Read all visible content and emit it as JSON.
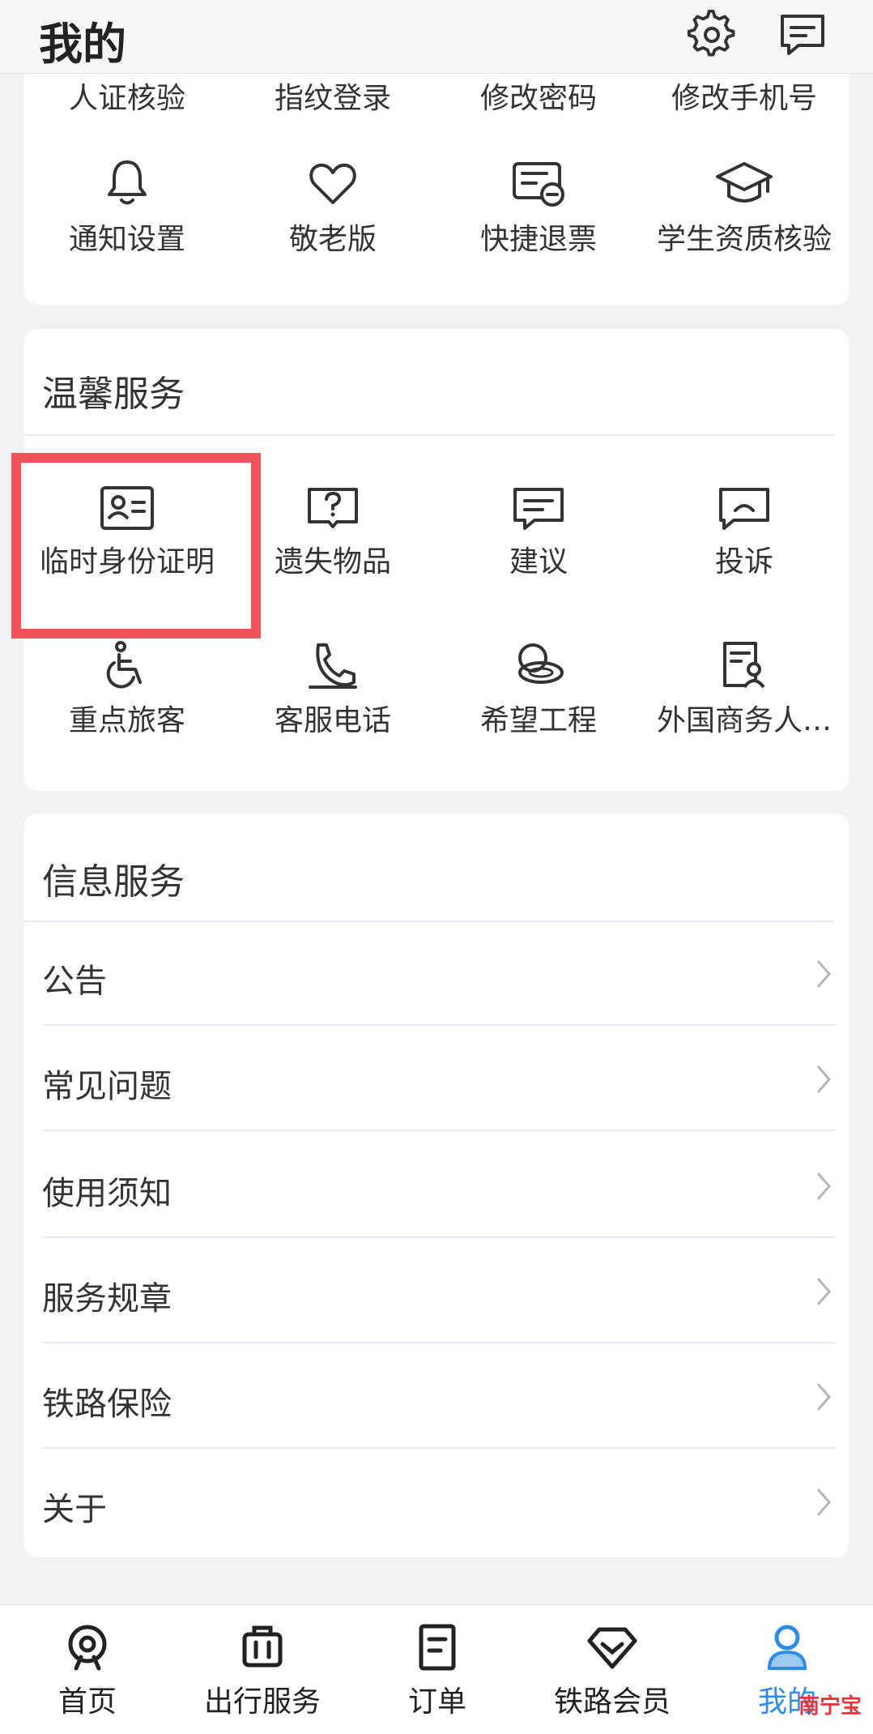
{
  "header": {
    "title": "我的",
    "settings_icon": "gear-icon",
    "message_icon": "message-icon"
  },
  "account_settings": {
    "row1": [
      "人证核验",
      "指纹登录",
      "修改密码",
      "修改手机号"
    ],
    "row2": [
      {
        "label": "通知设置",
        "icon": "bell-icon"
      },
      {
        "label": "敬老版",
        "icon": "heart-icon"
      },
      {
        "label": "快捷退票",
        "icon": "ticket-refund-icon"
      },
      {
        "label": "学生资质核验",
        "icon": "graduation-cap-icon"
      }
    ]
  },
  "warm_services": {
    "title": "温馨服务",
    "items": [
      {
        "label": "临时身份证明",
        "icon": "id-card-icon"
      },
      {
        "label": "遗失物品",
        "icon": "question-box-icon"
      },
      {
        "label": "建议",
        "icon": "suggestion-icon"
      },
      {
        "label": "投诉",
        "icon": "complaint-icon"
      },
      {
        "label": "重点旅客",
        "icon": "wheelchair-icon"
      },
      {
        "label": "客服电话",
        "icon": "phone-icon"
      },
      {
        "label": "希望工程",
        "icon": "hope-project-icon"
      },
      {
        "label": "外国商务人…",
        "icon": "foreign-business-icon"
      }
    ]
  },
  "info_services": {
    "title": "信息服务",
    "items": [
      "公告",
      "常见问题",
      "使用须知",
      "服务规章",
      "铁路保险",
      "关于"
    ]
  },
  "tabbar": {
    "items": [
      {
        "label": "首页",
        "icon": "home-icon"
      },
      {
        "label": "出行服务",
        "icon": "luggage-icon"
      },
      {
        "label": "订单",
        "icon": "order-icon"
      },
      {
        "label": "铁路会员",
        "icon": "diamond-icon"
      },
      {
        "label": "我的",
        "icon": "user-icon",
        "active": true
      }
    ]
  },
  "watermark": "南宁宝",
  "colors": {
    "accent": "#2f8de4",
    "highlight": "#f0535a"
  }
}
